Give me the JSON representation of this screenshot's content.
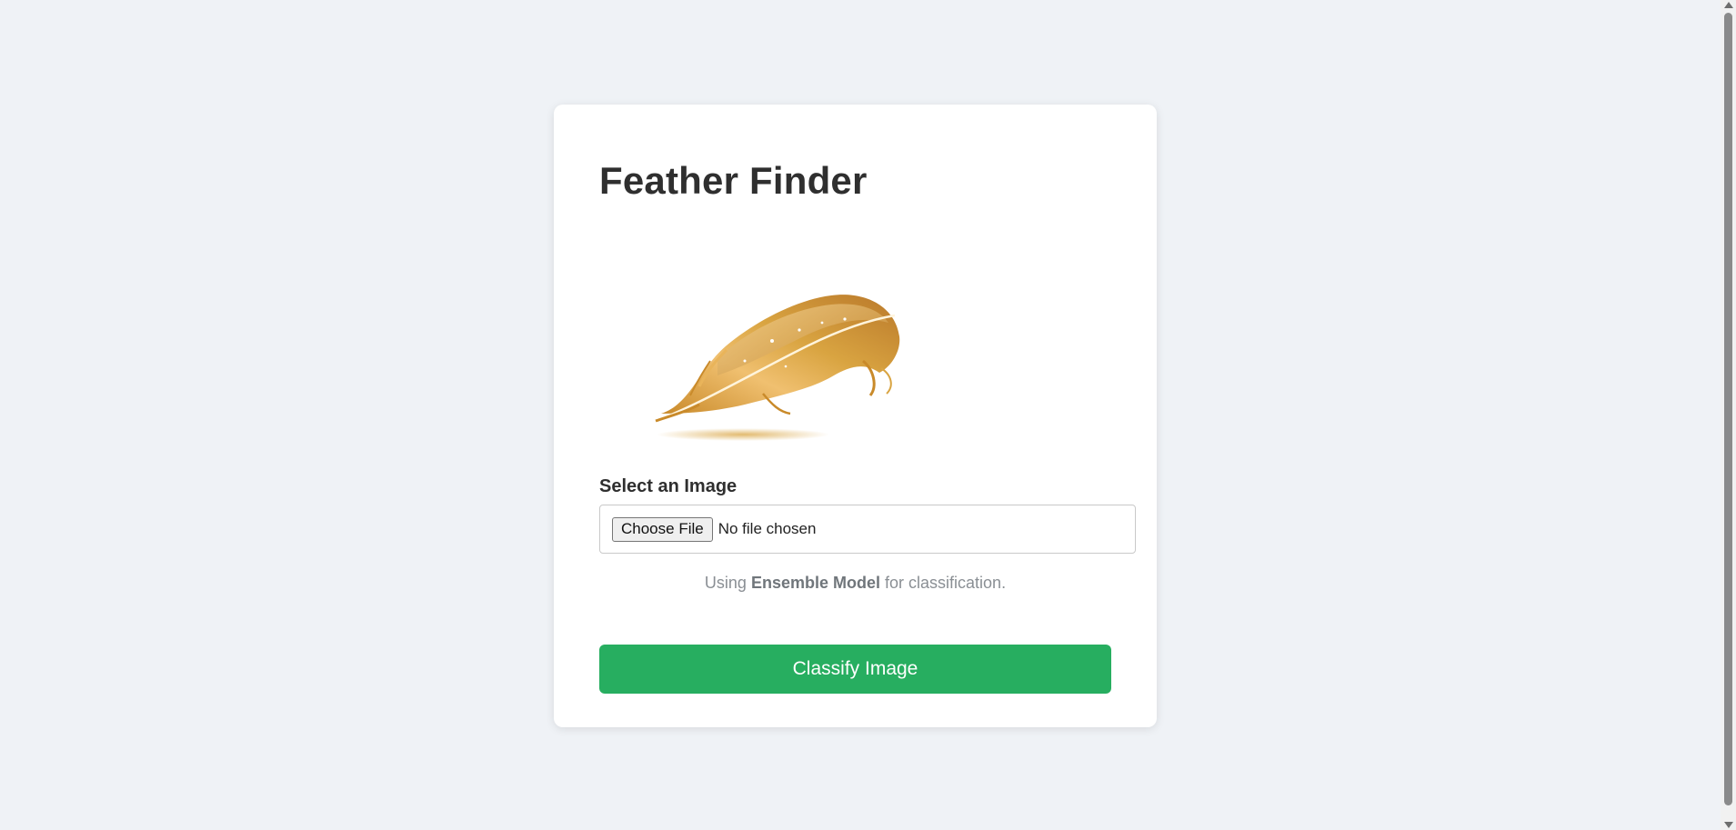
{
  "app": {
    "title": "Feather Finder"
  },
  "upload": {
    "label": "Select an Image",
    "choose_button": "Choose File",
    "file_status": "No file chosen"
  },
  "model_note": {
    "prefix": "Using",
    "model_name": "Ensemble Model",
    "suffix": "for classification."
  },
  "actions": {
    "classify_label": "Classify Image"
  },
  "colors": {
    "background": "#eff2f6",
    "card": "#ffffff",
    "accent_green": "#27ae60",
    "feather_gold": "#d9a441"
  },
  "icons": {
    "logo": "golden-feather-illustration"
  }
}
